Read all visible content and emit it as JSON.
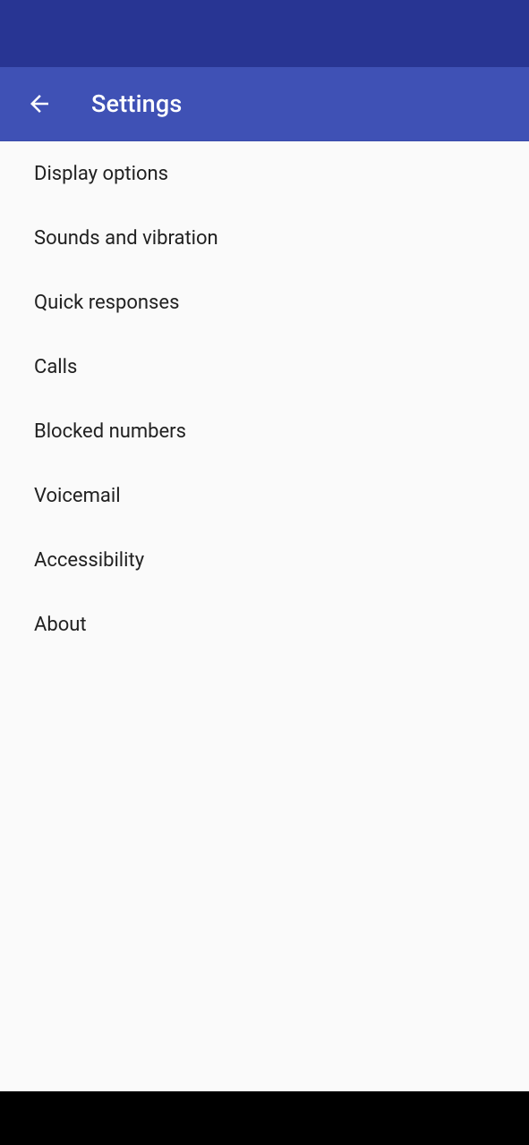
{
  "header": {
    "title": "Settings"
  },
  "items": [
    {
      "label": "Display options"
    },
    {
      "label": "Sounds and vibration"
    },
    {
      "label": "Quick responses"
    },
    {
      "label": "Calls"
    },
    {
      "label": "Blocked numbers"
    },
    {
      "label": "Voicemail"
    },
    {
      "label": "Accessibility"
    },
    {
      "label": "About"
    }
  ]
}
